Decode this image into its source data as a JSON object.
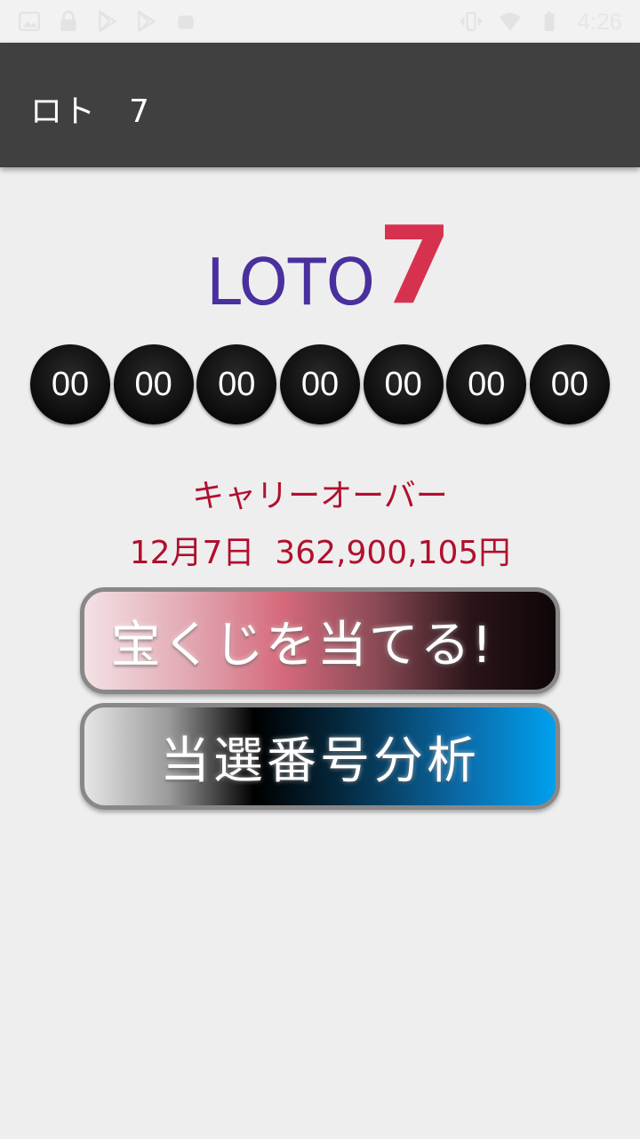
{
  "status_bar": {
    "time": "4:26",
    "left_icons": [
      "image-icon",
      "lock-icon",
      "play-store-icon",
      "play-store-icon",
      "android-icon"
    ],
    "right_icons": [
      "vibrate-icon",
      "wifi-icon",
      "battery-icon"
    ]
  },
  "app_bar": {
    "title": "ロト　7"
  },
  "logo": {
    "text": "LOTO",
    "number": "7",
    "text_color": "#4a2f9e",
    "number_color": "#d6324f"
  },
  "balls": [
    "00",
    "00",
    "00",
    "00",
    "00",
    "00",
    "00"
  ],
  "carryover": {
    "label": "キャリーオーバー",
    "info": "12月7日  362,900,105円",
    "color": "#b0102e"
  },
  "buttons": {
    "lottery_label": "宝くじを当てる!",
    "analysis_label": "当選番号分析"
  }
}
